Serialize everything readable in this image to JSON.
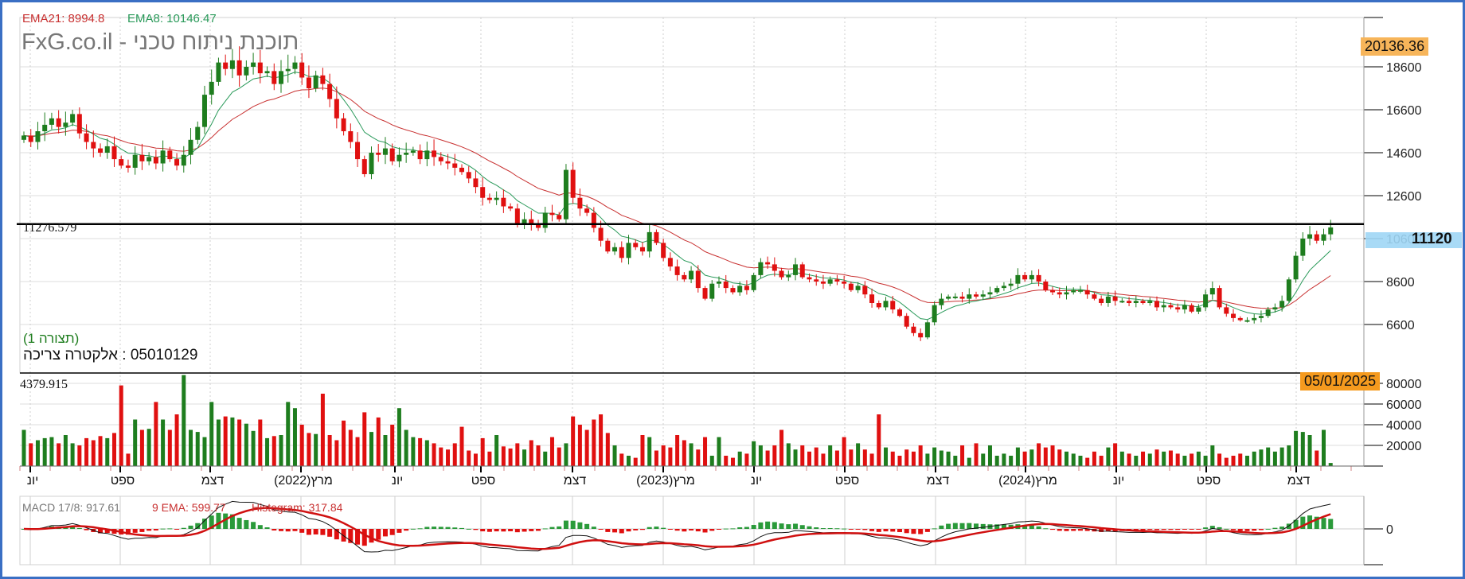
{
  "legend": {
    "ema21": "EMA21: 8994.8",
    "ema8": "EMA8: 10146.47"
  },
  "watermark": "FxG.co.il - תוכנת ניתוח טכני",
  "config_label": "(תצורה 1)",
  "instrument_label": "05010129 : אלקטרה צריכה",
  "hline_label": "11276.579",
  "volume_label": "4379.915",
  "badges": {
    "high": "20136.36",
    "last": "11120",
    "date": "05/01/2025"
  },
  "macd_legend": {
    "macd": "MACD 17/8: 917.61",
    "ema": "9 EMA: 599.77",
    "hist": "Histogram: 317.84"
  },
  "colors": {
    "up": "#1e7d1e",
    "down": "#e01010",
    "ema21": "#c83030",
    "ema8": "#2a9a5a",
    "badge_orange": "#f7a030",
    "badge_blue": "#9fd6f5"
  },
  "chart_data": {
    "type": "candlestick",
    "title": "05010129 : אלקטרה צריכה",
    "period": "weekly",
    "y_ticks": [
      "18600",
      "16600",
      "14600",
      "12600",
      "10600",
      "8600",
      "6600"
    ],
    "volume_ticks": [
      "80000",
      "60000",
      "40000",
      "20000"
    ],
    "macd_ticks": [
      "0"
    ],
    "x_labels": [
      "יונ",
      "ספט",
      "דצמ",
      "מרץ(2022)",
      "יונ",
      "ספט",
      "דצמ",
      "מרץ(2023)",
      "יונ",
      "ספט",
      "דצמ",
      "מרץ(2024)",
      "יונ",
      "ספט",
      "דצמ"
    ],
    "ylim": [
      5000,
      20200
    ],
    "horizontal_line": 11276.579,
    "close": [
      15400,
      15100,
      15600,
      15900,
      16200,
      15800,
      16000,
      16400,
      15500,
      15100,
      14800,
      14600,
      14900,
      14300,
      14000,
      13900,
      14500,
      14200,
      14400,
      14100,
      14700,
      14300,
      14000,
      14500,
      15200,
      15800,
      17300,
      17900,
      18800,
      18500,
      18900,
      18200,
      18600,
      18800,
      18300,
      18400,
      17800,
      18400,
      18500,
      18800,
      18100,
      17600,
      18200,
      17800,
      17100,
      16200,
      15600,
      15100,
      14300,
      13600,
      14600,
      14500,
      14800,
      14200,
      14500,
      14600,
      14700,
      14300,
      14700,
      14400,
      14200,
      14100,
      13900,
      13700,
      13400,
      13000,
      12500,
      12400,
      12500,
      12100,
      12000,
      11300,
      11500,
      11300,
      11100,
      11800,
      11700,
      11500,
      13800,
      12500,
      12000,
      11800,
      11100,
      10500,
      10000,
      10200,
      9700,
      10400,
      10200,
      10000,
      10900,
      10400,
      9700,
      9300,
      8900,
      8700,
      9100,
      8300,
      7800,
      8500,
      8600,
      8300,
      8100,
      8400,
      8200,
      8900,
      9500,
      9400,
      9100,
      8800,
      8900,
      9400,
      8800,
      8700,
      8600,
      8500,
      8700,
      8600,
      8500,
      8200,
      8400,
      8000,
      7600,
      7400,
      7700,
      7300,
      7000,
      6500,
      6200,
      6000,
      6700,
      7500,
      7800,
      7900,
      7900,
      7800,
      8000,
      7900,
      8000,
      8100,
      8300,
      8400,
      8500,
      8900,
      8700,
      8900,
      8600,
      8200,
      8100,
      8000,
      8100,
      8200,
      8200,
      8000,
      7800,
      7600,
      7900,
      7700,
      7700,
      7600,
      7700,
      7600,
      7700,
      7400,
      7500,
      7400,
      7300,
      7500,
      7200,
      7400,
      8000,
      8300,
      7400,
      7100,
      6900,
      6800,
      6800,
      6900,
      7000,
      7300,
      7400,
      7700,
      8700,
      9800,
      10600,
      10800,
      10500,
      10800,
      11120
    ],
    "volume": [
      35000,
      22000,
      25000,
      27000,
      28000,
      22000,
      30000,
      22000,
      20000,
      27000,
      25000,
      29000,
      27000,
      32000,
      78000,
      12000,
      45000,
      35000,
      36000,
      62000,
      45000,
      35000,
      50000,
      88000,
      35000,
      33000,
      28000,
      62000,
      45000,
      48000,
      47000,
      45000,
      41000,
      34000,
      45000,
      27000,
      29000,
      30000,
      62000,
      56000,
      40000,
      32000,
      31000,
      70000,
      30000,
      25000,
      44000,
      35000,
      28000,
      52000,
      33000,
      47000,
      30000,
      40000,
      56000,
      35000,
      28000,
      27000,
      25000,
      22000,
      18000,
      16000,
      22000,
      38000,
      15000,
      12000,
      27000,
      14000,
      30000,
      19000,
      17000,
      22000,
      16000,
      25000,
      20000,
      14000,
      28000,
      18000,
      22000,
      48000,
      40000,
      35000,
      45000,
      50000,
      32000,
      20000,
      12000,
      10000,
      8000,
      30000,
      28000,
      15000,
      20000,
      18000,
      30000,
      25000,
      22000,
      16000,
      28000,
      10000,
      28000,
      10000,
      8000,
      14000,
      12000,
      24000,
      20000,
      15000,
      20000,
      35000,
      22000,
      16000,
      20000,
      14000,
      18000,
      12000,
      20000,
      15000,
      28000,
      16000,
      22000,
      16000,
      12000,
      50000,
      18000,
      14000,
      10000,
      16000,
      14000,
      20000,
      12000,
      18000,
      15000,
      14000,
      10000,
      20000,
      8000,
      22000,
      12000,
      20000,
      10000,
      12000,
      10000,
      18000,
      14000,
      16000,
      22000,
      18000,
      20000,
      16000,
      14000,
      12000,
      10000,
      8000,
      14000,
      10000,
      18000,
      22000,
      14000,
      12000,
      10000,
      14000,
      12000,
      16000,
      14000,
      15000,
      12000,
      10000,
      12000,
      14000,
      10000,
      20000,
      12000,
      8000,
      10000,
      12000,
      10000,
      14000,
      16000,
      18000,
      14000,
      18000,
      20000,
      34000,
      33000,
      30000,
      15000,
      35000,
      3000
    ],
    "indicators": {
      "ema_periods": [
        21,
        8
      ],
      "macd": {
        "fast": 8,
        "slow": 17,
        "signal": 9
      }
    }
  }
}
